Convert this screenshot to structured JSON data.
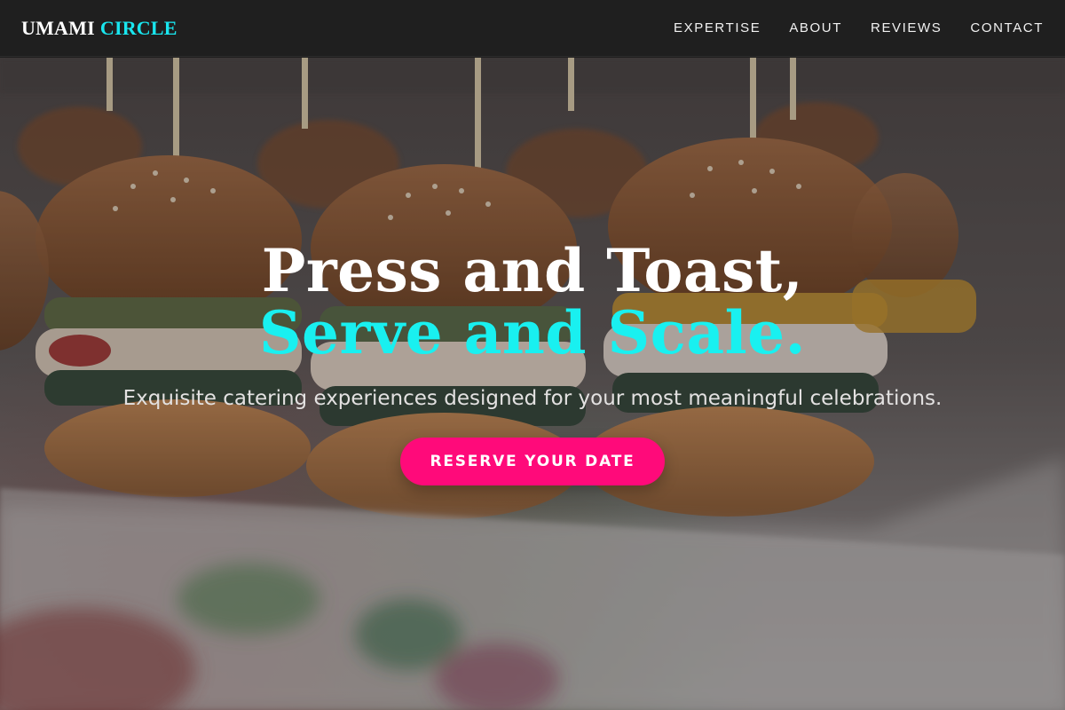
{
  "brand": {
    "part1": "UMAMI",
    "part2": "CIRCLE"
  },
  "nav": {
    "items": [
      {
        "label": "EXPERTISE"
      },
      {
        "label": "ABOUT"
      },
      {
        "label": "REVIEWS"
      },
      {
        "label": "CONTACT"
      }
    ]
  },
  "hero": {
    "headline_line1": "Press and Toast,",
    "headline_line2": "Serve and Scale.",
    "subtitle": "Exquisite catering experiences designed for your most meaningful celebrations.",
    "cta_label": "RESERVE YOUR DATE",
    "background_image": "sliders-on-toothpicks-photo"
  },
  "colors": {
    "accent_cyan": "#19e6ef",
    "cta_pink": "#ff0a7a",
    "nav_bg": "#1f1f1f"
  }
}
